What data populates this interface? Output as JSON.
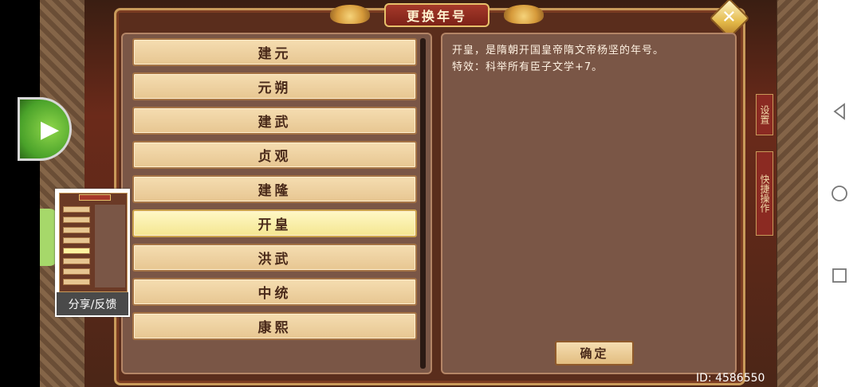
{
  "dialog": {
    "title": "更换年号",
    "close_icon": "close-icon"
  },
  "eras": [
    {
      "label": "建元",
      "selected": false
    },
    {
      "label": "元朔",
      "selected": false
    },
    {
      "label": "建武",
      "selected": false
    },
    {
      "label": "贞观",
      "selected": false
    },
    {
      "label": "建隆",
      "selected": false
    },
    {
      "label": "开皇",
      "selected": true
    },
    {
      "label": "洪武",
      "selected": false
    },
    {
      "label": "中统",
      "selected": false
    },
    {
      "label": "康熙",
      "selected": false
    }
  ],
  "description": {
    "line1": "开皇，是隋朝开国皇帝隋文帝杨坚的年号。",
    "line2": "特效：科举所有臣子文学+7。"
  },
  "confirm_label": "确定",
  "side_tabs": {
    "settings": "设置",
    "quick_ops": "快捷操作"
  },
  "share": {
    "label": "分享/反馈"
  },
  "id_text": "ID: 4586550",
  "colors": {
    "panel_bg": "#7a5646",
    "button_bg": "#f0d6a6",
    "selected_bg": "#fff3a8",
    "title_red": "#a6392a"
  }
}
